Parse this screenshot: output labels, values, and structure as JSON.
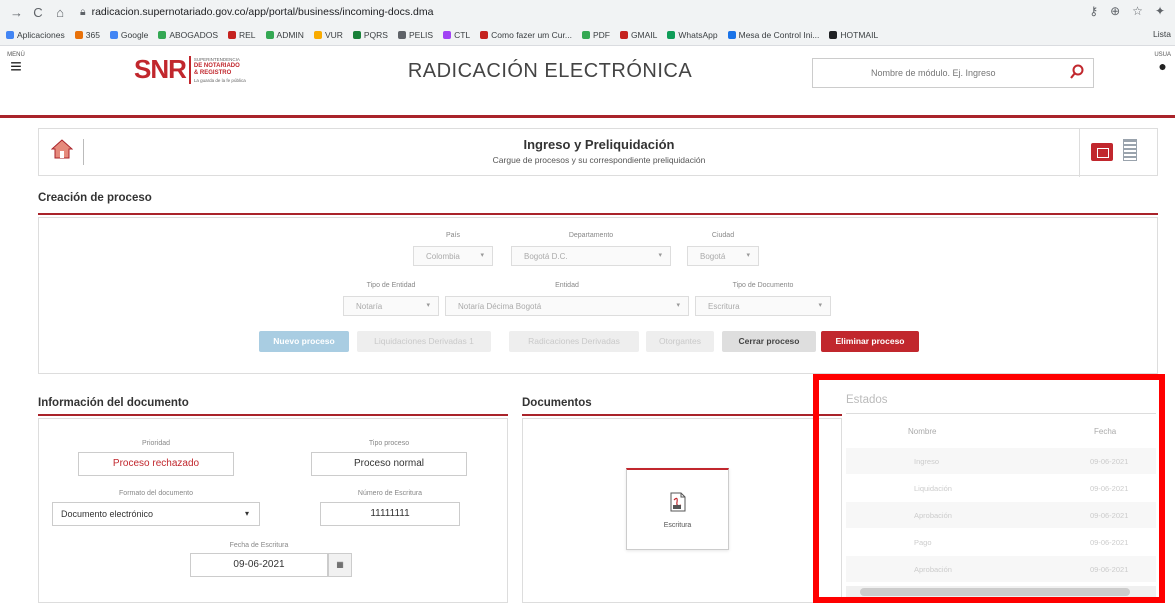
{
  "browser": {
    "url": "radicacion.supernotariado.gov.co/app/portal/business/incoming-docs.dma",
    "bookmarks": [
      "Aplicaciones",
      "365",
      "Google",
      "ABOGADOS",
      "REL",
      "ADMIN",
      "VUR",
      "PQRS",
      "PELIS",
      "CTL",
      "Como fazer um Cur...",
      "PDF",
      "GMAIL",
      "WhatsApp",
      "Mesa de Control Ini...",
      "HOTMAIL"
    ],
    "bookmarks_right": "Lista"
  },
  "header": {
    "menu_label": "MENÚ",
    "logo_text": "SNR",
    "logo_sub1": "SUPERINTENDENCIA",
    "logo_sub2": "DE NOTARIADO",
    "logo_sub3": "& REGISTRO",
    "logo_sub4": "La guarda de la fe pública",
    "title": "RADICACIÓN ELECTRÓNICA",
    "search_placeholder": "Nombre de módulo. Ej. Ingreso",
    "user_label": "USUA"
  },
  "ingreso": {
    "title": "Ingreso y Preliquidación",
    "subtitle": "Cargue de procesos y su correspondiente preliquidación"
  },
  "creacion": {
    "heading": "Creación de proceso",
    "pais_label": "País",
    "pais_value": "Colombia",
    "depto_label": "Departamento",
    "depto_value": "Bogotá D.C.",
    "ciudad_label": "Ciudad",
    "ciudad_value": "Bogotá",
    "tipo_entidad_label": "Tipo de Entidad",
    "tipo_entidad_value": "Notaría",
    "entidad_label": "Entidad",
    "entidad_value": "Notaría Décima Bogotá",
    "tipo_doc_label": "Tipo de Documento",
    "tipo_doc_value": "Escritura",
    "btn_nuevo": "Nuevo proceso",
    "btn_liq": "Liquidaciones Derivadas 1",
    "btn_rad": "Radicaciones Derivadas",
    "btn_otorg": "Otorgantes",
    "btn_cerrar": "Cerrar proceso",
    "btn_eliminar": "Eliminar proceso"
  },
  "documento": {
    "heading": "Información del documento",
    "prioridad_label": "Prioridad",
    "prioridad_value": "Proceso rechazado",
    "tipo_proceso_label": "Tipo proceso",
    "tipo_proceso_value": "Proceso normal",
    "formato_label": "Formato del documento",
    "formato_value": "Documento electrónico",
    "numero_label": "Número de Escritura",
    "numero_value": "11111111",
    "fecha_label": "Fecha de Escritura",
    "fecha_value": "09-06-2021"
  },
  "documentos": {
    "heading": "Documentos",
    "card_label": "Escritura"
  },
  "estados": {
    "heading": "Estados",
    "col_nombre": "Nombre",
    "col_fecha": "Fecha",
    "rows": [
      {
        "nombre": "Ingreso",
        "fecha": "09-06-2021"
      },
      {
        "nombre": "Liquidación",
        "fecha": "09-06-2021"
      },
      {
        "nombre": "Aprobación",
        "fecha": "09-06-2021"
      },
      {
        "nombre": "Pago",
        "fecha": "09-06-2021"
      },
      {
        "nombre": "Aprobación",
        "fecha": "09-06-2021"
      }
    ]
  },
  "colors": {
    "brand_red": "#c1272d",
    "highlight_red": "#ff0000",
    "disabled_blue": "#a9cde2"
  }
}
